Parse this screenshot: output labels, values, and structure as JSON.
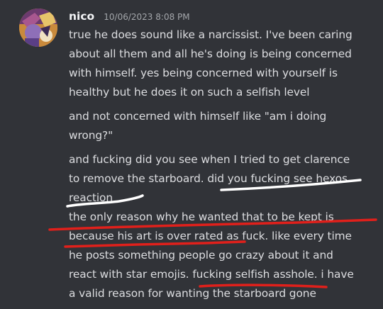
{
  "message": {
    "author": "nico",
    "timestamp": "10/06/2023 8:08 PM",
    "lines": [
      "true he does sound like a narcissist. I've been caring",
      "about all them and all he's doing is being concerned",
      "with himself. yes being concerned with yourself is",
      "healthy but he does it on such a selfish level",
      "and not concerned with himself like \"am i doing",
      "wrong?\"",
      "and fucking did you see when I tried to get clarence",
      "to remove the starboard. did you fucking see hexos",
      "reaction",
      "the only reason why he wanted that to be kept is",
      "because his art is over rated as fuck. like every time",
      "he posts something people go crazy about it and",
      "react with star emojis. fucking selfish asshole. i have",
      "a valid reason for wanting the starboard gone"
    ]
  },
  "annotations": {
    "white_underline_color": "#ffffff",
    "red_underline_color": "#e0201b"
  }
}
